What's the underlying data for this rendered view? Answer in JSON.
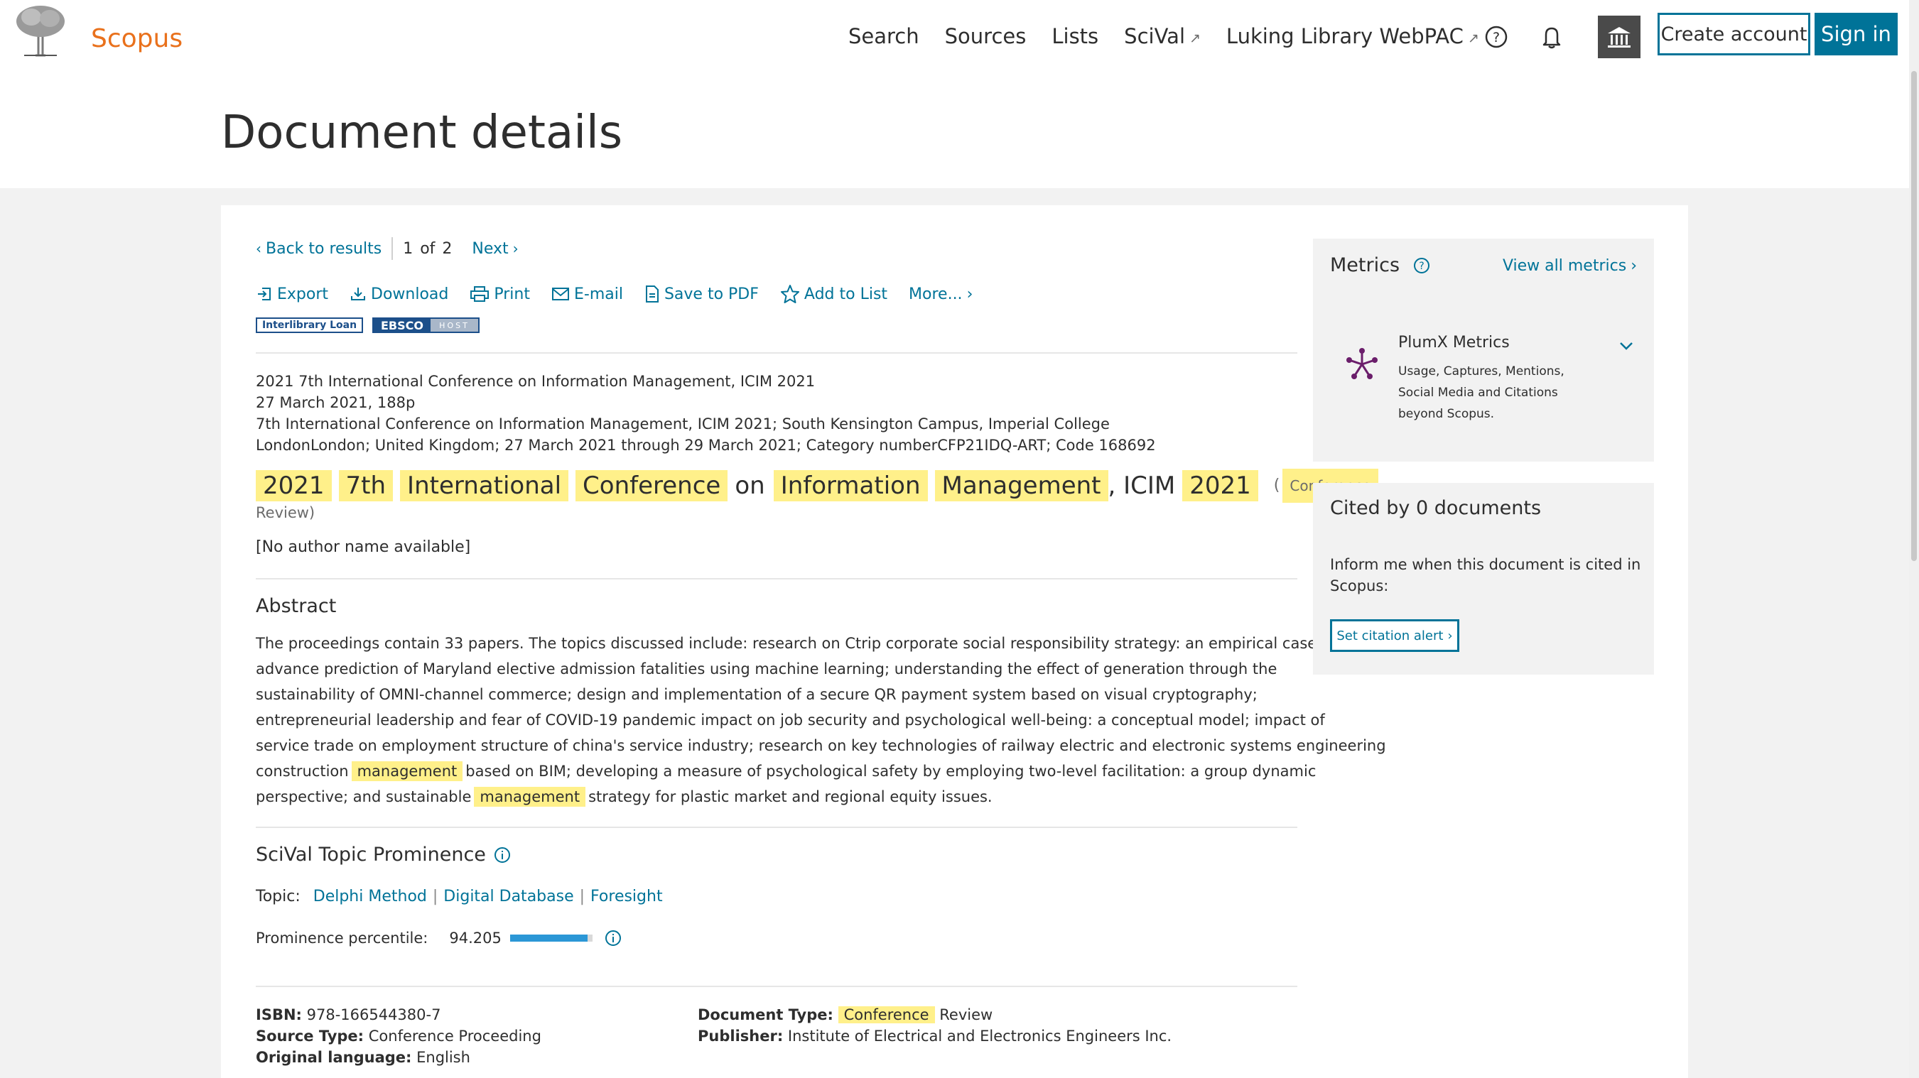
{
  "header": {
    "brand": "Scopus",
    "nav": [
      {
        "label": "Search",
        "external": false
      },
      {
        "label": "Sources",
        "external": false
      },
      {
        "label": "Lists",
        "external": false
      },
      {
        "label": "SciVal",
        "external": true
      },
      {
        "label": "Luking Library WebPAC",
        "external": true
      }
    ],
    "create_account": "Create account",
    "sign_in": "Sign in"
  },
  "page_title": "Document details",
  "pager": {
    "back": "Back to results",
    "current": "1",
    "of": "of",
    "total": "2",
    "next": "Next"
  },
  "actions": [
    "Export",
    "Download",
    "Print",
    "E-mail",
    "Save to PDF",
    "Add to List",
    "More..."
  ],
  "partner_logos": {
    "interlibrary": "Interlibrary Loan",
    "ebsco": "EBSCO",
    "ebsco_host": "HOST"
  },
  "source": {
    "line1": "2021 7th International Conference on Information Management, ICIM 2021",
    "line2": "27 March 2021, 188p",
    "line3": "7th International Conference on Information Management, ICIM 2021; South Kensington Campus, Imperial College",
    "line4": "LondonLondon; United Kingdom; 27 March 2021 through 29 March 2021; Category numberCFP21IDQ-ART; Code 168692"
  },
  "title": {
    "parts": [
      {
        "text": "2021",
        "hl": true
      },
      {
        "text": "7th",
        "hl": true
      },
      {
        "text": "International",
        "hl": true
      },
      {
        "text": "Conference",
        "hl": true
      },
      {
        "text": "on",
        "hl": false
      },
      {
        "text": "Information",
        "hl": true
      },
      {
        "text": "Management",
        "hl": true
      },
      {
        "text": ", ICIM",
        "hl": false
      },
      {
        "text": "2021",
        "hl": true
      }
    ],
    "paren_open": "(",
    "badge": "Conference",
    "badge_rest": "Review)"
  },
  "author": "[No author name available]",
  "abstract": {
    "heading": "Abstract",
    "line1": "The proceedings contain 33 papers. The topics discussed include: research on Ctrip corporate social responsibility strategy: an empirical case;",
    "line2": "advance prediction of Maryland elective admission fatalities using machine learning; understanding the effect of generation through the",
    "line3": "sustainability of OMNI-channel commerce; design and implementation of a secure QR payment system based on visual cryptography;",
    "line4": "entrepreneurial leadership and fear of COVID-19 pandemic impact on job security and psychological well-being: a conceptual model; impact of",
    "line5": "service trade on employment structure of china's service industry; research on key technologies of railway electric and electronic systems engineering",
    "line6_a": "construction",
    "line6_hl": "management",
    "line6_b": "based on BIM; developing a measure of psychological safety by employing two-level facilitation: a group dynamic",
    "line7_a": "perspective; and sustainable",
    "line7_hl": "management",
    "line7_b": "strategy for plastic market and regional equity issues."
  },
  "scival": {
    "heading": "SciVal Topic Prominence",
    "topic_label": "Topic:",
    "topics": [
      "Delphi Method",
      "Digital Database",
      "Foresight"
    ],
    "prominence_label": "Prominence percentile:",
    "prominence_value": "94.205",
    "prominence_pct": 94.205
  },
  "meta": {
    "isbn_label": "ISBN:",
    "isbn": "978-166544380-7",
    "source_type_label": "Source Type:",
    "source_type": "Conference Proceeding",
    "language_label": "Original language:",
    "language": "English",
    "doc_type_label": "Document Type:",
    "doc_type_hl": "Conference",
    "doc_type_rest": "Review",
    "publisher_label": "Publisher:",
    "publisher": "Institute of Electrical and Electronics Engineers Inc."
  },
  "metrics": {
    "title": "Metrics",
    "view_all": "View all metrics",
    "plumx_title": "PlumX Metrics",
    "plumx_desc1": "Usage, Captures, Mentions,",
    "plumx_desc2": "Social Media and Citations",
    "plumx_desc3": "beyond Scopus."
  },
  "cited": {
    "title": "Cited by 0 documents",
    "text1": "Inform me when this document is cited in",
    "text2": "Scopus:",
    "alert_button": "Set citation alert"
  },
  "colors": {
    "accent": "#007398",
    "brand": "#e9711c",
    "highlight": "#fff08a",
    "progress": "#2b97d6"
  }
}
